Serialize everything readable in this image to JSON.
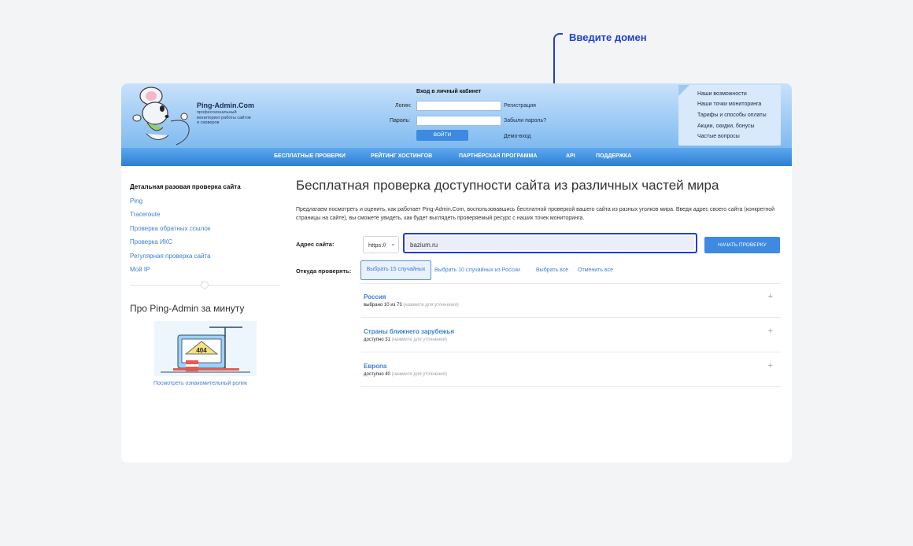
{
  "annotation": {
    "label": "Введите домен"
  },
  "brand": {
    "name": "Ping-Admin.Com",
    "tagline": "профессиональный мониторинг работы сайтов и серверов"
  },
  "login": {
    "title": "Вход в личный кабинет",
    "login_label": "Логин:",
    "password_label": "Пароль:",
    "submit": "ВОЙТИ",
    "register": "Регистрация",
    "forgot": "Забыли пароль?",
    "demo": "Демо-вход"
  },
  "top_menu": [
    "Наши возможности",
    "Наши точки мониторинга",
    "Тарифы и способы оплаты",
    "Акции, скидки, бонусы",
    "Частые вопросы"
  ],
  "nav": [
    "БЕСПЛАТНЫЕ ПРОВЕРКИ",
    "РЕЙТИНГ ХОСТИНГОВ",
    "ПАРТНЁРСКАЯ ПРОГРАММА",
    "API",
    "ПОДДЕРЖКА"
  ],
  "sidebar": {
    "title": "Детальная разовая проверка сайта",
    "links": [
      "Ping",
      "Traceroute",
      "Проверка обратных ссылок",
      "Проверка ИКС",
      "Регулярная проверка сайта",
      "Мой IP"
    ],
    "promo_title": "Про Ping-Admin за минуту",
    "promo_link": "Посмотреть ознакомительный ролик",
    "promo_badge": "404"
  },
  "main": {
    "title": "Бесплатная проверка доступности сайта из различных частей мира",
    "intro": "Предлагаем посмотреть и оценить, как работает Ping-Admin.Com, воспользовавшись бесплатной проверкой вашего сайта из разных уголков мира. Введя адрес своего сайта (конкретной страницы на сайте), вы сможете увидеть, как будет выглядеть проверяемый ресурс с наших точек мониторинга.",
    "address_label": "Адрес сайта:",
    "protocol": "https://",
    "domain_value": "bazium.ru",
    "start_button": "НАЧАТЬ ПРОВЕРКУ",
    "from_label": "Откуда проверять:",
    "pick_options": [
      "Выбрать 15 случайных",
      "Выбрать 10 случайных из России",
      "Выбрать все",
      "Отменить все"
    ],
    "groups": [
      {
        "name": "Россия",
        "meta": "выбрано 10 из 73",
        "hint": "(нажмите для уточнения)"
      },
      {
        "name": "Страны ближнего зарубежья",
        "meta": "доступно 31",
        "hint": "(нажмите для уточнения)"
      },
      {
        "name": "Европа",
        "meta": "доступно 40",
        "hint": "(нажмите для уточнения)"
      }
    ]
  }
}
